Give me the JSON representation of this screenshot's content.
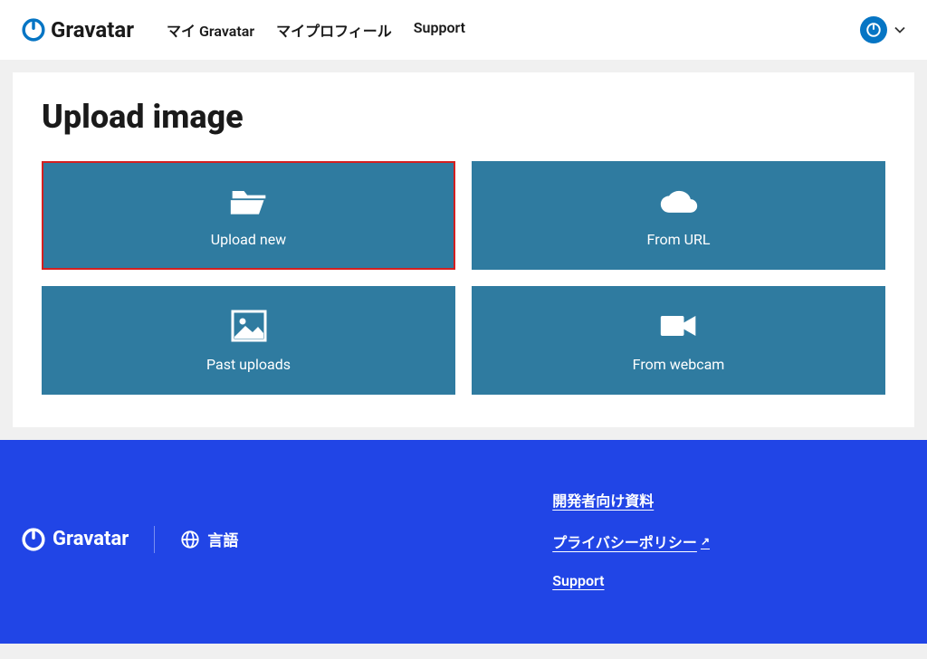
{
  "header": {
    "brand": "Gravatar",
    "nav": [
      {
        "label": "マイ Gravatar"
      },
      {
        "label": "マイプロフィール"
      },
      {
        "label": "Support"
      }
    ]
  },
  "page": {
    "title": "Upload image",
    "tiles": [
      {
        "label": "Upload new",
        "icon": "folder-open",
        "highlighted": true
      },
      {
        "label": "From URL",
        "icon": "cloud",
        "highlighted": false
      },
      {
        "label": "Past uploads",
        "icon": "image",
        "highlighted": false
      },
      {
        "label": "From webcam",
        "icon": "video-camera",
        "highlighted": false
      }
    ]
  },
  "footer": {
    "brand": "Gravatar",
    "language_label": "言語",
    "links": [
      {
        "label": "開発者向け資料",
        "external": false
      },
      {
        "label": "プライバシーポリシー",
        "external": true
      },
      {
        "label": "Support",
        "external": false
      }
    ]
  },
  "colors": {
    "brand_blue": "#0675c4",
    "tile_bg": "#2f7ba0",
    "footer_bg": "#2145e6",
    "highlight_border": "#d32020"
  }
}
